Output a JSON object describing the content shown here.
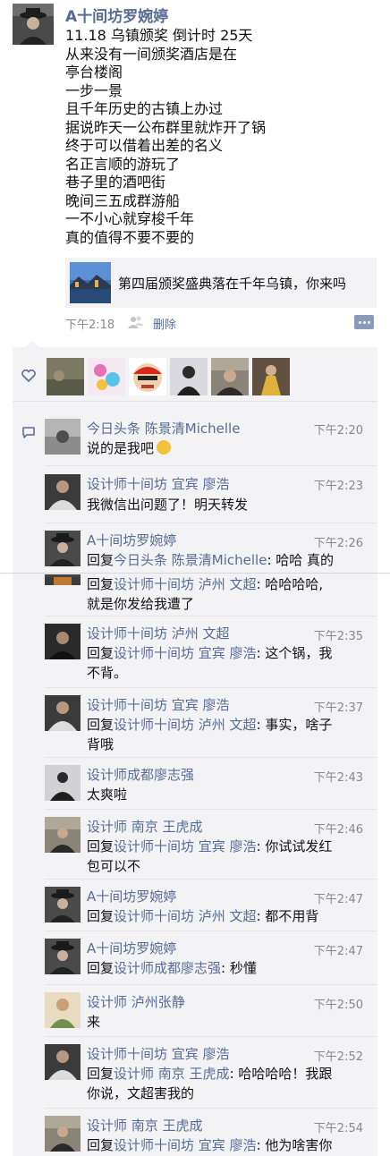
{
  "post": {
    "author": "A十间坊罗婉婷",
    "lines": [
      "11.18 乌镇颁奖 倒计时 25天",
      "从来没有一间颁奖酒店是在",
      "亭台楼阁",
      "一步一景",
      "且千年历史的古镇上办过",
      "据说昨天一公布群里就炸开了锅",
      "终于可以借着出差的名义",
      "名正言顺的游玩了",
      "巷子里的酒吧街",
      "晚间三五成群游船",
      "一不小心就穿梭千年",
      "真的值得不要不要的"
    ],
    "shared_link_title": "第四届颁奖盛典落在千年乌镇，你来吗",
    "time": "下午2:18",
    "delete_label": "删除"
  },
  "icons": {
    "likes": "heart-icon",
    "comments": "comment-bubble-icon",
    "visibility": "people-icon",
    "more": "more-dots-icon"
  },
  "colors": {
    "name_link": "#576b95",
    "panel_bg": "#f3f3f5",
    "meta_gray": "#888888"
  },
  "comments": [
    {
      "name": "今日头条 陈景清Michelle",
      "time": "下午2:20",
      "text": "说的是我吧"
    },
    {
      "name": "设计师十间坊 宜宾 廖浩",
      "time": "下午2:23",
      "text": "我微信出问题了！明天转发"
    },
    {
      "name": "A十间坊罗婉婷",
      "time": "下午2:26",
      "reply_prefix": "回复",
      "reply_to": "今日头条 陈景清Michelle",
      "text": ": 哈哈 真的"
    },
    {
      "reply_prefix": "回复",
      "reply_to": "设计师十间坊 泸州 文超",
      "text": ": 哈哈哈哈,",
      "text2": "就是你发给我遭了"
    },
    {
      "name": "设计师十间坊 泸州 文超",
      "time": "下午2:35",
      "reply_prefix": "回复",
      "reply_to": "设计师十间坊 宜宾 廖浩",
      "text": ": 这个锅，我",
      "text2": "不背。"
    },
    {
      "name": "设计师十间坊 宜宾 廖浩",
      "time": "下午2:37",
      "reply_prefix": "回复",
      "reply_to": "设计师十间坊 泸州 文超",
      "text": ": 事实，啥子",
      "text2": "背哦"
    },
    {
      "name": "设计师成都廖志强",
      "time": "下午2:43",
      "text": "太爽啦"
    },
    {
      "name": "设计师 南京 王虎成",
      "time": "下午2:46",
      "reply_prefix": "回复",
      "reply_to": "设计师十间坊 宜宾 廖浩",
      "text": ": 你试试发红",
      "text2": "包可以不"
    },
    {
      "name": "A十间坊罗婉婷",
      "time": "下午2:47",
      "reply_prefix": "回复",
      "reply_to": "设计师十间坊 泸州 文超",
      "text": ": 都不用背"
    },
    {
      "name": "A十间坊罗婉婷",
      "time": "下午2:47",
      "reply_prefix": "回复",
      "reply_to": "设计师成都廖志强",
      "text": ": 秒懂"
    },
    {
      "name": "设计师 泸州张静",
      "time": "下午2:50",
      "text": "来"
    },
    {
      "name": "设计师十间坊 宜宾 廖浩",
      "time": "下午2:52",
      "reply_prefix": "回复",
      "reply_to": "设计师 南京 王虎成",
      "text": ": 哈哈哈哈！我跟",
      "text2": "你说，文超害我的"
    },
    {
      "name": "设计师 南京 王虎成",
      "time": "下午2:54",
      "reply_prefix": "回复",
      "reply_to": "设计师十间坊 宜宾 廖浩",
      "text": ": 他为啥害你"
    }
  ]
}
